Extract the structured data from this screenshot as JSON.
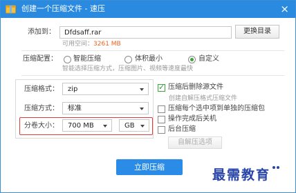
{
  "window": {
    "title": "创建一个压缩文件 - 速压",
    "close_glyph": "×",
    "icon": "archive-app-icon",
    "accent_color": "#2a8ae0"
  },
  "add_to": {
    "label": "添加到：",
    "value": "Dfdsaff.rar",
    "change_dir_label": "更换目录"
  },
  "space": {
    "label": "可用空间：",
    "value": "3261 MB",
    "value_color": "#e8641e"
  },
  "config": {
    "label": "压缩配置：",
    "options": [
      {
        "label": "智能压缩",
        "selected": false
      },
      {
        "label": "体积最小",
        "selected": false
      },
      {
        "label": "自定义",
        "selected": true
      }
    ],
    "hint": "智能选择压缩方式，压缩图片、视频等速度最快"
  },
  "format": {
    "label": "压缩格式：",
    "value": "zip"
  },
  "method": {
    "label": "压缩方式：",
    "value": "标准"
  },
  "split": {
    "label": "分卷大小：",
    "size_value": "700 MB",
    "unit_value": "GB"
  },
  "options": {
    "delete_source": {
      "label": "压缩后删除源文件",
      "checked": true
    },
    "create_sfx_hint": "创建自解压格式压缩文件",
    "each_separate": {
      "label": "压缩每个选中项到单独的压缩包",
      "checked": false
    },
    "shutdown": {
      "label": "操作完成后关机",
      "checked": false
    },
    "background": {
      "label": "后台压缩",
      "checked": false
    },
    "sfx_options_button": "自解压选项"
  },
  "action": {
    "compress_now": "立即压缩",
    "color": "#2b8ce8"
  },
  "watermark": {
    "text": "最需教育"
  }
}
